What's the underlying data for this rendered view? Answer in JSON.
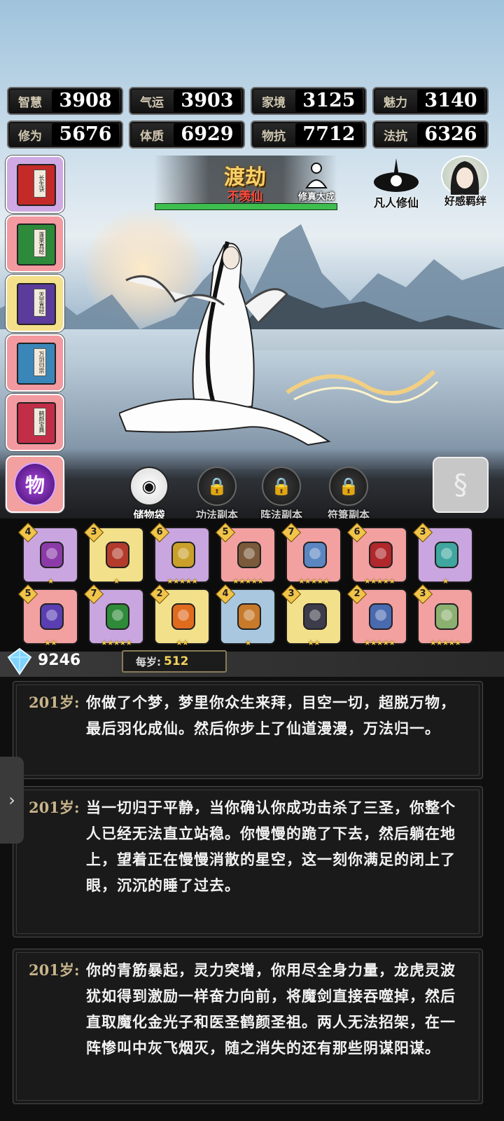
{
  "stats": [
    {
      "label": "智慧",
      "value": "3908"
    },
    {
      "label": "气运",
      "value": "3903"
    },
    {
      "label": "家境",
      "value": "3125"
    },
    {
      "label": "魅力",
      "value": "3140"
    },
    {
      "label": "修为",
      "value": "5676"
    },
    {
      "label": "体质",
      "value": "6929"
    },
    {
      "label": "物抗",
      "value": "7712"
    },
    {
      "label": "法抗",
      "value": "6326"
    }
  ],
  "left_books": [
    {
      "name": "长生诀",
      "color": "#c42a28"
    },
    {
      "name": "蓬莱真经",
      "color": "#2d8a3a"
    },
    {
      "name": "天罡真经",
      "color": "#5b3b9b"
    },
    {
      "name": "万剑归宗",
      "color": "#3a86b8"
    },
    {
      "name": "鹤颜宝典",
      "color": "#c22e47"
    }
  ],
  "left_bottom_badge": "物",
  "tribulation": {
    "title": "渡劫",
    "subtitle": "不羡仙",
    "progress": 1.0
  },
  "top_buttons": {
    "cultivation": "修真大成",
    "mortal": "凡人修仙",
    "affinity": "好感羁绊"
  },
  "tabs": [
    {
      "label": "储物袋",
      "locked": false
    },
    {
      "label": "功法副本",
      "locked": true
    },
    {
      "label": "阵法副本",
      "locked": true
    },
    {
      "label": "符箓副本",
      "locked": true
    }
  ],
  "items": [
    {
      "level": "4",
      "stars": 1,
      "bg": "#c9a6df"
    },
    {
      "level": "3",
      "stars": 1,
      "bg": "#f3e08a"
    },
    {
      "level": "6",
      "stars": 5,
      "bg": "#c9a6df"
    },
    {
      "level": "5",
      "stars": 5,
      "bg": "#f2a0a0"
    },
    {
      "level": "7",
      "stars": 5,
      "bg": "#f2a0a0"
    },
    {
      "level": "6",
      "stars": 5,
      "bg": "#f2a0a0"
    },
    {
      "level": "3",
      "stars": 1,
      "bg": "#c9a6df"
    },
    {
      "level": "5",
      "stars": 2,
      "bg": "#f2a0a0"
    },
    {
      "level": "7",
      "stars": 5,
      "bg": "#c9a6df"
    },
    {
      "level": "2",
      "stars": 2,
      "bg": "#f3e08a"
    },
    {
      "level": "4",
      "stars": 1,
      "bg": "#a9c8e0"
    },
    {
      "level": "3",
      "stars": 2,
      "bg": "#f3e08a"
    },
    {
      "level": "2",
      "stars": 5,
      "bg": "#f2a0a0"
    },
    {
      "level": "3",
      "stars": 5,
      "bg": "#f2a0a0"
    }
  ],
  "currency": {
    "amount": "9246",
    "per_label": "每岁:",
    "per_value": "512"
  },
  "log": [
    {
      "age": "201岁:",
      "text": "你做了个梦，梦里你众生来拜，目空一切，超脱万物，最后羽化成仙。然后你步上了仙道漫漫，万法归一。"
    },
    {
      "age": "201岁:",
      "text": "当一切归于平静，当你确认你成功击杀了三圣，你整个人已经无法直立站稳。你慢慢的跪了下去，然后躺在地上，望着正在慢慢消散的星空，这一刻你满足的闭上了眼，沉沉的睡了过去。"
    },
    {
      "age": "201岁:",
      "text": "你的青筋暴起，灵力突增，你用尽全身力量，龙虎灵波犹如得到激励一样奋力向前，将魔剑直接吞噬掉，然后直取魔化金光子和医圣鹤颜圣祖。两人无法招架，在一阵惨叫中灰飞烟灭，随之消失的还有那些阴谋阳谋。"
    }
  ]
}
